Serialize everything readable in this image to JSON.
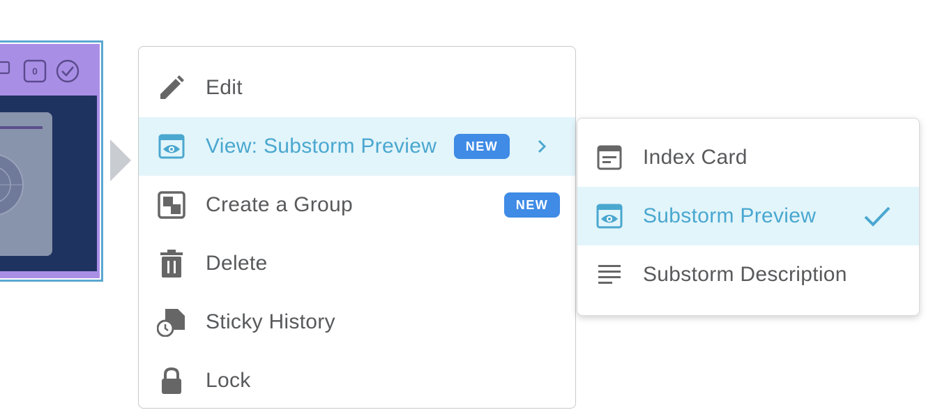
{
  "card": {
    "counter_value": "0"
  },
  "menu": {
    "items": [
      {
        "label": "Edit",
        "icon": "pencil-icon"
      },
      {
        "label": "View: Substorm Preview",
        "icon": "preview-eye-icon",
        "badge": "NEW",
        "has_submenu": true,
        "active": true
      },
      {
        "label": "Create a Group",
        "icon": "group-icon",
        "badge": "NEW"
      },
      {
        "label": "Delete",
        "icon": "trash-icon"
      },
      {
        "label": "Sticky History",
        "icon": "history-icon"
      },
      {
        "label": "Lock",
        "icon": "lock-icon"
      }
    ]
  },
  "submenu": {
    "items": [
      {
        "label": "Index Card",
        "icon": "index-card-icon"
      },
      {
        "label": "Substorm Preview",
        "icon": "preview-eye-icon",
        "selected": true
      },
      {
        "label": "Substorm Description",
        "icon": "description-lines-icon"
      }
    ]
  },
  "colors": {
    "accent": "#4aa7cf",
    "badge": "#3f8be6",
    "highlight": "#e2f5fb",
    "card": "#a98ee6",
    "card_body": "#1f3360"
  }
}
